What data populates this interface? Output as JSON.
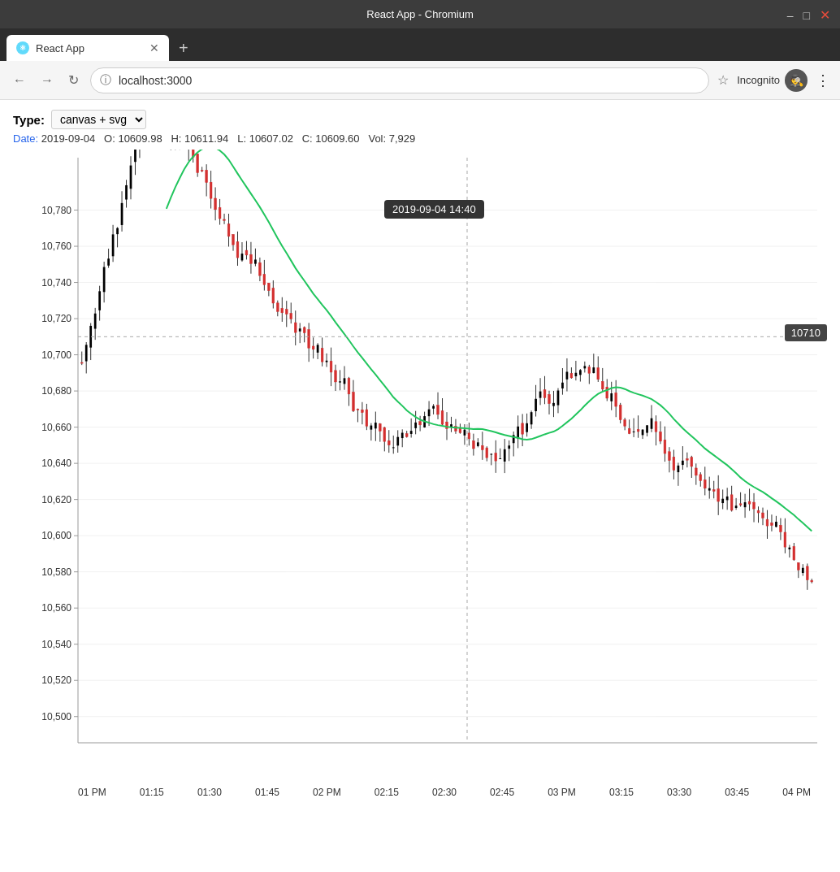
{
  "browser": {
    "title": "React App - Chromium",
    "tab": {
      "label": "React App",
      "favicon": "R"
    },
    "address": "localhost:3000",
    "incognito_label": "Incognito"
  },
  "app": {
    "type_label": "Type:",
    "type_value": "canvas + svg",
    "ohlcv": {
      "date_label": "Date:",
      "date_value": "2019-09-04",
      "o_label": "O:",
      "o_value": "10609.98",
      "h_label": "H:",
      "h_value": "10611.94",
      "l_label": "L:",
      "l_value": "10607.02",
      "c_label": "C:",
      "c_value": "10609.60",
      "vol_label": "Vol:",
      "vol_value": "7,929"
    },
    "crosshair_tooltip": "2019-09-04 14:40",
    "price_label": "10710",
    "y_axis": [
      "10,780",
      "10,760",
      "10,740",
      "10,720",
      "10,700",
      "10,680",
      "10,660",
      "10,640",
      "10,620",
      "10,600",
      "10,580",
      "10,560",
      "10,540",
      "10,520",
      "10,500"
    ],
    "x_axis": [
      "01 PM",
      "01:15",
      "01:30",
      "01:45",
      "02 PM",
      "02:15",
      "02:30",
      "02:45",
      "03 PM",
      "03:15",
      "03:30",
      "03:45",
      "04 PM"
    ]
  }
}
